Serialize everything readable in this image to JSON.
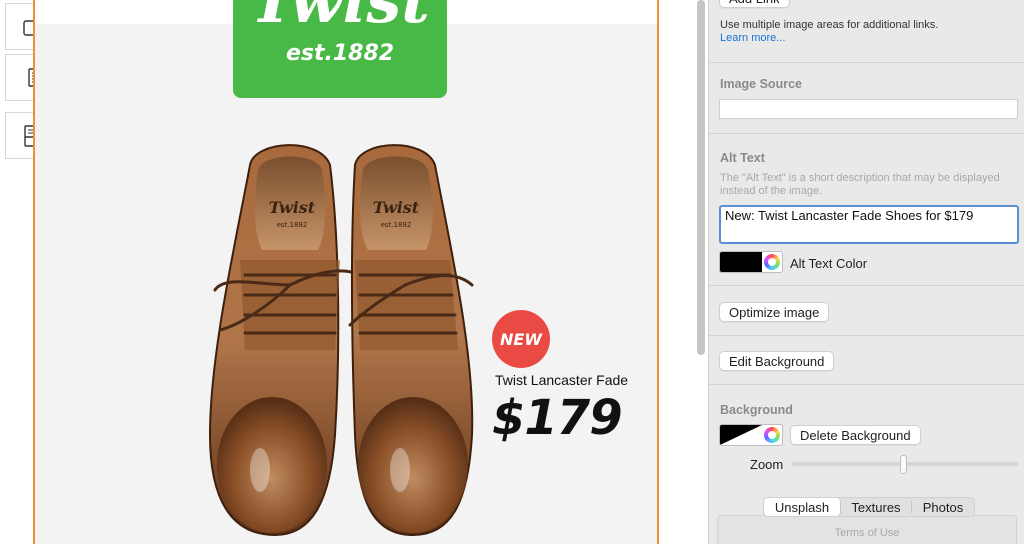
{
  "editor": {
    "tools": [
      {
        "icon": "mobile-tablet-icon"
      },
      {
        "icon": "document-icon"
      },
      {
        "icon": "layout-block-icon"
      }
    ]
  },
  "email": {
    "logo_word": "Twist",
    "logo_sub": "est.1882",
    "badge": "NEW",
    "product_name": "Twist Lancaster Fade",
    "product_price": "$179",
    "image_brand_mark": "Twist est.1882",
    "colors": {
      "frame": "#e9922f",
      "logo_bg": "#48b946",
      "badge_bg": "#ea4a44"
    }
  },
  "panel": {
    "add_link_label": "Add Link",
    "link_hint": "Use multiple image areas for additional links.",
    "learn_more": "Learn more...",
    "image_source": {
      "title": "Image Source",
      "value": ""
    },
    "alt_text": {
      "title": "Alt Text",
      "hint": "The \"Alt Text\" is a short description that may be displayed instead of the image.",
      "value": "New: Twist Lancaster Fade Shoes for $179",
      "color_label": "Alt Text Color",
      "color": "#000000"
    },
    "optimize_label": "Optimize image",
    "edit_background_label": "Edit Background",
    "background": {
      "title": "Background",
      "delete_label": "Delete Background",
      "zoom_label": "Zoom",
      "zoom_value": 0.5
    },
    "tabs": [
      "Unsplash",
      "Textures",
      "Photos"
    ],
    "active_tab": "Unsplash",
    "terms": "Terms of Use",
    "colors": {
      "link": "#1a73d9",
      "focus": "#5a8fd6"
    }
  }
}
